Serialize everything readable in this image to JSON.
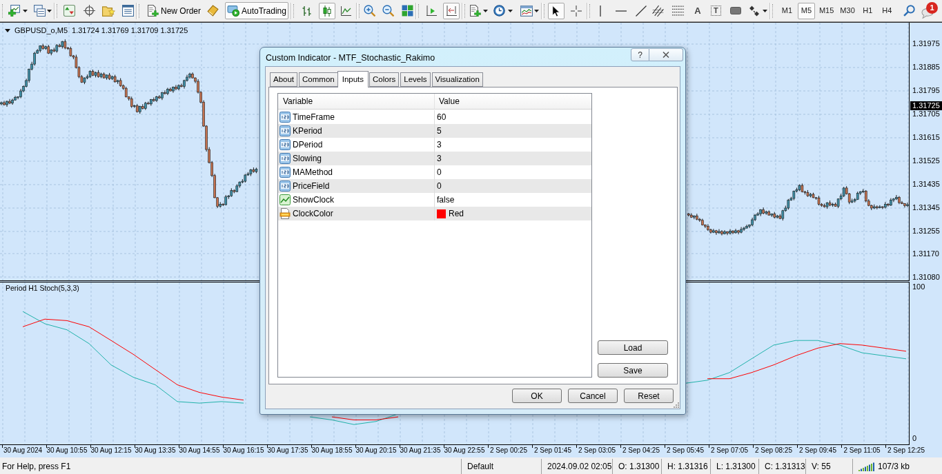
{
  "toolbar": {
    "new_order": {
      "label": "New Order"
    },
    "auto_trading": {
      "label": "AutoTrading",
      "pressed": true
    },
    "chart_types": [
      {
        "selected": false
      },
      {
        "selected": true
      },
      {
        "selected": false
      }
    ],
    "chart_shift": {
      "pressed": false
    },
    "auto_scroll": {
      "pressed": true
    },
    "pointer_tools": [
      {
        "selected": true
      },
      {
        "selected": false
      }
    ],
    "text_tool": {
      "label": "A"
    },
    "label_tool": {
      "label": "T"
    },
    "timeframes": [
      {
        "label": "M1",
        "selected": false
      },
      {
        "label": "M5",
        "selected": true
      },
      {
        "label": "M15",
        "selected": false
      },
      {
        "label": "M30",
        "selected": false
      },
      {
        "label": "H1",
        "selected": false
      },
      {
        "label": "H4",
        "selected": false
      }
    ],
    "notifications": {
      "badge": "1"
    }
  },
  "chart": {
    "symbol": "GBPUSD_o,M5",
    "ohlc": "1.31724 1.31769 1.31709 1.31725",
    "current_price": "1.31725",
    "price_chart": {
      "chart_data": {
        "type": "candlestick",
        "ylim": [
          1.31067,
          1.32057
        ],
        "grid": true,
        "yticks": [
          {
            "value": 1.31975,
            "label": "1.31975"
          },
          {
            "value": 1.31885,
            "label": "1.31885"
          },
          {
            "value": 1.31795,
            "label": "1.31795"
          },
          {
            "value": 1.31705,
            "label": "1.31705"
          },
          {
            "value": 1.31615,
            "label": "1.31615"
          },
          {
            "value": 1.31525,
            "label": "1.31525"
          },
          {
            "value": 1.31435,
            "label": "1.31435"
          },
          {
            "value": 1.31345,
            "label": "1.31345"
          },
          {
            "value": 1.31255,
            "label": "1.31255"
          },
          {
            "value": 1.3117,
            "label": "1.31170"
          },
          {
            "value": 1.3108,
            "label": "1.31080"
          }
        ],
        "categories": [
          null,
          null,
          null,
          null,
          null,
          null,
          null,
          null,
          null,
          null,
          null,
          null,
          null,
          null,
          null,
          null,
          null,
          null,
          null,
          null,
          null,
          null,
          null,
          null,
          null,
          null,
          null,
          null,
          null,
          null,
          null,
          null,
          null,
          null,
          null,
          null,
          null,
          null,
          null,
          null,
          null,
          null,
          null,
          null,
          null,
          null,
          null,
          null,
          null,
          null,
          null,
          null,
          null,
          null,
          null,
          null,
          null,
          null,
          null,
          null,
          null,
          null,
          null,
          null,
          null,
          null,
          null,
          null,
          null,
          null,
          null,
          null,
          null,
          null,
          null,
          null,
          null,
          null,
          null,
          null,
          null,
          null,
          null,
          null,
          null,
          null,
          null,
          null,
          null,
          null,
          null,
          null,
          null,
          null,
          null,
          null,
          null,
          null,
          null,
          null,
          null,
          null,
          null,
          null,
          null,
          null,
          null,
          null,
          null,
          null,
          null,
          null,
          null,
          null,
          null,
          null,
          null,
          null,
          null,
          null,
          null,
          null,
          null,
          null,
          null,
          null,
          null,
          null,
          null,
          null,
          null,
          null,
          null,
          null,
          null,
          null,
          null,
          null,
          null,
          null,
          null,
          null,
          null,
          null,
          null,
          null,
          null,
          null,
          null,
          null,
          null,
          null,
          null,
          null,
          null,
          null,
          null,
          null,
          null,
          null,
          null,
          null,
          null,
          null,
          null,
          null,
          null,
          null,
          null,
          null,
          null,
          null,
          null,
          null,
          null,
          null,
          null,
          null,
          null,
          null,
          null,
          null,
          null,
          null,
          null,
          null,
          null,
          null,
          null,
          null,
          null,
          null,
          null,
          null,
          null,
          null,
          null,
          null,
          null,
          null,
          null,
          null,
          null,
          null,
          null,
          null,
          null,
          null,
          null,
          null,
          null,
          null,
          null,
          null,
          null,
          null,
          null,
          null,
          null,
          null,
          null,
          null,
          null,
          null,
          null,
          null,
          null,
          null,
          null,
          null,
          null,
          null,
          null,
          null,
          null,
          null,
          null,
          null,
          null,
          null,
          null,
          null,
          null,
          null,
          null,
          null,
          null,
          null,
          null,
          null,
          null,
          null,
          null,
          null,
          null,
          null,
          null,
          null,
          null,
          null,
          null,
          null,
          null,
          null,
          null,
          null,
          null,
          null,
          null,
          null,
          null,
          null,
          null,
          null,
          null,
          null,
          null,
          null,
          null,
          null,
          null,
          null,
          null,
          null,
          null,
          null,
          null,
          null,
          null,
          null,
          null,
          null,
          null,
          null,
          null,
          null,
          null,
          null,
          null,
          null,
          null,
          null,
          null,
          null,
          null,
          null,
          null,
          null,
          null,
          null,
          null,
          null,
          null,
          null,
          null,
          null,
          null,
          null,
          null,
          null,
          null,
          null,
          null,
          null,
          null,
          null,
          null,
          null
        ],
        "ohlc": [
          [
            1.31745,
            1.31754,
            1.3174,
            1.3175
          ],
          [
            1.3175,
            1.31757,
            1.31739,
            1.31742
          ],
          [
            1.31742,
            1.31758,
            1.31734,
            1.31755
          ],
          [
            1.31755,
            1.31764,
            1.31744,
            1.31748
          ],
          [
            1.31748,
            1.31765,
            1.31742,
            1.3176
          ],
          [
            1.3176,
            1.31776,
            1.31758,
            1.3177
          ],
          [
            1.3177,
            1.31774,
            1.31763,
            1.31772
          ],
          [
            1.31772,
            1.31803,
            1.31767,
            1.31795
          ],
          [
            1.31795,
            1.31816,
            1.3179,
            1.31812
          ],
          [
            1.31812,
            1.31842,
            1.31809,
            1.31835
          ],
          [
            1.31835,
            1.31881,
            1.31827,
            1.31878
          ],
          [
            1.31878,
            1.31907,
            1.31874,
            1.31898
          ],
          [
            1.31898,
            1.31945,
            1.31892,
            1.3194
          ],
          [
            1.3194,
            1.31956,
            1.31938,
            1.3195
          ],
          [
            1.3195,
            1.3197,
            1.31943,
            1.31968
          ],
          [
            1.31968,
            1.31976,
            1.31953,
            1.31958
          ],
          [
            1.31958,
            1.31969,
            1.31953,
            1.31965
          ],
          [
            1.31965,
            1.31972,
            1.31937,
            1.3194
          ],
          [
            1.3194,
            1.31955,
            1.31932,
            1.31952
          ],
          [
            1.31952,
            1.31961,
            1.31944,
            1.31948
          ],
          [
            1.31948,
            1.31975,
            1.31942,
            1.3197
          ],
          [
            1.3197,
            1.31976,
            1.31963,
            1.31965
          ],
          [
            1.31965,
            1.31987,
            1.31958,
            1.31985
          ],
          [
            1.31985,
            1.31993,
            1.31955,
            1.3196
          ],
          [
            1.3196,
            1.31964,
            1.31953,
            1.31958
          ],
          [
            1.31958,
            1.31965,
            1.31927,
            1.3193
          ],
          [
            1.3193,
            1.31933,
            1.31917,
            1.31925
          ],
          [
            1.31925,
            1.31934,
            1.31881,
            1.31885
          ],
          [
            1.31885,
            1.3189,
            1.31844,
            1.3185
          ],
          [
            1.3185,
            1.31856,
            1.31826,
            1.31828
          ],
          [
            1.31828,
            1.31847,
            1.31821,
            1.31845
          ],
          [
            1.31845,
            1.31858,
            1.3184,
            1.3185
          ],
          [
            1.3185,
            1.31874,
            1.31845,
            1.3187
          ],
          [
            1.3187,
            1.31877,
            1.31852,
            1.31855
          ],
          [
            1.31855,
            1.31869,
            1.31847,
            1.31866
          ],
          [
            1.31866,
            1.31875,
            1.31846,
            1.3185
          ],
          [
            1.3185,
            1.31865,
            1.31844,
            1.3186
          ],
          [
            1.3186,
            1.31866,
            1.31843,
            1.31845
          ],
          [
            1.31845,
            1.31858,
            1.31838,
            1.31856
          ],
          [
            1.31856,
            1.31864,
            1.31837,
            1.31842
          ],
          [
            1.31842,
            1.31854,
            1.31837,
            1.3185
          ],
          [
            1.3185,
            1.31857,
            1.31827,
            1.3183
          ],
          [
            1.3183,
            1.31838,
            1.31822,
            1.31835
          ],
          [
            1.31835,
            1.31844,
            1.31811,
            1.31815
          ],
          [
            1.31815,
            1.3182,
            1.31799,
            1.31805
          ],
          [
            1.31805,
            1.31811,
            1.3177,
            1.31772
          ],
          [
            1.31772,
            1.31774,
            1.31758,
            1.31765
          ],
          [
            1.31765,
            1.31773,
            1.3173,
            1.31735
          ],
          [
            1.31735,
            1.31742,
            1.3173,
            1.31738
          ],
          [
            1.31738,
            1.31745,
            1.31712,
            1.31715
          ],
          [
            1.31715,
            1.31738,
            1.31707,
            1.31735
          ],
          [
            1.31735,
            1.31744,
            1.31724,
            1.31728
          ],
          [
            1.31728,
            1.31753,
            1.31722,
            1.31748
          ],
          [
            1.31748,
            1.31754,
            1.31743,
            1.31745
          ],
          [
            1.31745,
            1.31764,
            1.31738,
            1.31762
          ],
          [
            1.31762,
            1.3177,
            1.31753,
            1.31758
          ],
          [
            1.31758,
            1.31776,
            1.31753,
            1.31772
          ],
          [
            1.31772,
            1.31779,
            1.31765,
            1.31768
          ],
          [
            1.31768,
            1.31791,
            1.3176,
            1.31788
          ],
          [
            1.31788,
            1.31797,
            1.31781,
            1.31785
          ],
          [
            1.31785,
            1.31807,
            1.31779,
            1.31802
          ],
          [
            1.31802,
            1.31808,
            1.31793,
            1.31795
          ],
          [
            1.31795,
            1.31812,
            1.31788,
            1.3181
          ],
          [
            1.3181,
            1.31818,
            1.31798,
            1.31803
          ],
          [
            1.31803,
            1.3182,
            1.31798,
            1.31816
          ],
          [
            1.31816,
            1.31823,
            1.31809,
            1.31812
          ],
          [
            1.31812,
            1.31838,
            1.31804,
            1.31835
          ],
          [
            1.31835,
            1.31857,
            1.31831,
            1.31848
          ],
          [
            1.31848,
            1.31865,
            1.31842,
            1.3186
          ],
          [
            1.3186,
            1.31866,
            1.31843,
            1.31845
          ],
          [
            1.31845,
            1.31847,
            1.31825,
            1.31832
          ],
          [
            1.31832,
            1.3184,
            1.31785,
            1.3179
          ],
          [
            1.3179,
            1.31794,
            1.31747,
            1.31752
          ],
          [
            1.31752,
            1.31759,
            1.31657,
            1.3166
          ],
          [
            1.3166,
            1.31663,
            1.31562,
            1.3157
          ],
          [
            1.3157,
            1.31579,
            1.31516,
            1.3152
          ],
          [
            1.3152,
            1.31525,
            1.31464,
            1.3147
          ],
          [
            1.3147,
            1.31476,
            1.31383,
            1.31385
          ],
          [
            1.31385,
            1.31387,
            1.31345,
            1.31352
          ],
          [
            1.31352,
            1.31368,
            1.31347,
            1.3136
          ],
          [
            1.3136,
            1.31364,
            1.31353,
            1.31358
          ],
          [
            1.31358,
            1.31395,
            1.31355,
            1.31388
          ],
          [
            1.31388,
            1.31395,
            1.3138,
            1.31392
          ],
          [
            1.31392,
            1.31421,
            1.31388,
            1.31412
          ],
          [
            1.31412,
            1.31417,
            1.31402,
            1.31408
          ],
          [
            1.31408,
            1.31436,
            1.31406,
            1.3143
          ],
          [
            1.3143,
            1.31447,
            1.31423,
            1.31445
          ],
          [
            1.31445,
            1.31456,
            1.3144,
            1.31448
          ],
          [
            1.31448,
            1.31476,
            1.31443,
            1.31472
          ],
          [
            1.31472,
            1.31483,
            1.31469,
            1.31476
          ],
          [
            1.31476,
            1.31495,
            1.31468,
            1.31492
          ],
          [
            1.31492,
            1.31501,
            1.31481,
            1.31485
          ],
          [
            1.31485,
            1.315,
            1.31479,
            1.31495
          ],
          null,
          null,
          null,
          null,
          null,
          null,
          null,
          null,
          null,
          null,
          null,
          null,
          null,
          null,
          null,
          null,
          null,
          null,
          null,
          null,
          null,
          null,
          null,
          null,
          null,
          null,
          null,
          null,
          null,
          null,
          null,
          null,
          null,
          null,
          null,
          null,
          null,
          null,
          null,
          null,
          null,
          null,
          null,
          null,
          null,
          null,
          null,
          null,
          null,
          null,
          null,
          null,
          null,
          null,
          null,
          null,
          null,
          null,
          null,
          null,
          null,
          null,
          null,
          null,
          null,
          null,
          null,
          null,
          null,
          null,
          null,
          null,
          null,
          null,
          null,
          null,
          null,
          null,
          null,
          null,
          null,
          null,
          null,
          null,
          null,
          null,
          null,
          null,
          null,
          null,
          null,
          null,
          null,
          null,
          null,
          null,
          null,
          null,
          null,
          null,
          null,
          null,
          null,
          null,
          null,
          null,
          null,
          null,
          null,
          null,
          null,
          null,
          null,
          null,
          null,
          null,
          null,
          null,
          null,
          null,
          null,
          null,
          null,
          null,
          null,
          null,
          null,
          null,
          null,
          null,
          null,
          null,
          null,
          null,
          null,
          null,
          null,
          null,
          null,
          null,
          null,
          null,
          null,
          null,
          null,
          null,
          null,
          null,
          null,
          null,
          null,
          null,
          null,
          null,
          null,
          [
            1.31322,
            1.31326,
            1.31313,
            1.31318
          ],
          [
            1.31318,
            1.31325,
            1.31307,
            1.3131
          ],
          [
            1.3131,
            1.31317,
            1.31302,
            1.31314
          ],
          [
            1.31314,
            1.31323,
            1.31298,
            1.31302
          ],
          [
            1.31302,
            1.31307,
            1.31292,
            1.31298
          ],
          [
            1.31298,
            1.31304,
            1.31278,
            1.3128
          ],
          [
            1.3128,
            1.31282,
            1.31268,
            1.31275
          ],
          [
            1.31275,
            1.31283,
            1.31257,
            1.31262
          ],
          [
            1.31262,
            1.31266,
            1.31247,
            1.31252
          ],
          [
            1.31252,
            1.31265,
            1.31249,
            1.31258
          ],
          [
            1.31258,
            1.31261,
            1.31242,
            1.3125
          ],
          [
            1.3125,
            1.31264,
            1.31246,
            1.31255
          ],
          [
            1.31255,
            1.3126,
            1.3124,
            1.31246
          ],
          [
            1.31246,
            1.3126,
            1.31244,
            1.31254
          ],
          [
            1.31254,
            1.31256,
            1.31241,
            1.31248
          ],
          [
            1.31248,
            1.31264,
            1.31243,
            1.31256
          ],
          [
            1.31256,
            1.3126,
            1.31245,
            1.3125
          ],
          [
            1.3125,
            1.31265,
            1.31247,
            1.31258
          ],
          [
            1.31258,
            1.31261,
            1.31244,
            1.31252
          ],
          [
            1.31252,
            1.31272,
            1.31248,
            1.31263
          ],
          [
            1.31263,
            1.31273,
            1.31257,
            1.31268
          ],
          [
            1.31268,
            1.31281,
            1.31266,
            1.31275
          ],
          [
            1.31275,
            1.31282,
            1.31268,
            1.3128
          ],
          [
            1.3128,
            1.31308,
            1.31275,
            1.313
          ],
          [
            1.313,
            1.31322,
            1.31295,
            1.31318
          ],
          [
            1.31318,
            1.31329,
            1.31315,
            1.31322
          ],
          [
            1.31322,
            1.31341,
            1.31314,
            1.31338
          ],
          [
            1.31338,
            1.31347,
            1.31321,
            1.31325
          ],
          [
            1.31325,
            1.31335,
            1.31319,
            1.3133
          ],
          [
            1.3133,
            1.31336,
            1.31316,
            1.31318
          ],
          [
            1.31318,
            1.31324,
            1.31311,
            1.31322
          ],
          [
            1.31322,
            1.3133,
            1.31305,
            1.3131
          ],
          [
            1.3131,
            1.31319,
            1.31305,
            1.31315
          ],
          [
            1.31315,
            1.31322,
            1.31302,
            1.31305
          ],
          [
            1.31305,
            1.31338,
            1.31297,
            1.31335
          ],
          [
            1.31335,
            1.31354,
            1.31331,
            1.31345
          ],
          [
            1.31345,
            1.3138,
            1.31339,
            1.31375
          ],
          [
            1.31375,
            1.31388,
            1.31373,
            1.31382
          ],
          [
            1.31382,
            1.31412,
            1.31375,
            1.3141
          ],
          [
            1.3141,
            1.31423,
            1.31405,
            1.31415
          ],
          [
            1.31415,
            1.31436,
            1.3141,
            1.31432
          ],
          [
            1.31432,
            1.31439,
            1.31405,
            1.31408
          ],
          [
            1.31408,
            1.31411,
            1.31397,
            1.31405
          ],
          [
            1.31405,
            1.31414,
            1.31388,
            1.31392
          ],
          [
            1.31392,
            1.31403,
            1.31386,
            1.31398
          ],
          [
            1.31398,
            1.31404,
            1.31383,
            1.31385
          ],
          [
            1.31385,
            1.31387,
            1.31377,
            1.31384
          ],
          [
            1.31384,
            1.31392,
            1.31355,
            1.3136
          ],
          [
            1.3136,
            1.31364,
            1.3135,
            1.31355
          ],
          [
            1.31355,
            1.31362,
            1.31347,
            1.3135
          ],
          [
            1.3135,
            1.31368,
            1.31342,
            1.31365
          ],
          [
            1.31365,
            1.31374,
            1.31352,
            1.31356
          ],
          [
            1.31356,
            1.31365,
            1.3135,
            1.3136
          ],
          [
            1.3136,
            1.31366,
            1.3135,
            1.31352
          ],
          [
            1.31352,
            1.31382,
            1.31345,
            1.3138
          ],
          [
            1.3138,
            1.314,
            1.31375,
            1.31392
          ],
          [
            1.31392,
            1.31426,
            1.31387,
            1.31422
          ],
          [
            1.31422,
            1.31429,
            1.31397,
            1.314
          ],
          [
            1.314,
            1.31403,
            1.3136,
            1.31368
          ],
          [
            1.31368,
            1.31381,
            1.31364,
            1.31372
          ],
          [
            1.31372,
            1.31383,
            1.31366,
            1.31378
          ],
          [
            1.31378,
            1.31408,
            1.31376,
            1.31402
          ],
          [
            1.31402,
            1.3141,
            1.31395,
            1.31408
          ],
          [
            1.31408,
            1.31418,
            1.31403,
            1.3141
          ],
          [
            1.3141,
            1.31414,
            1.31367,
            1.31372
          ],
          [
            1.31372,
            1.31379,
            1.31352,
            1.31355
          ],
          [
            1.31355,
            1.31358,
            1.31337,
            1.31345
          ],
          [
            1.31345,
            1.31359,
            1.31341,
            1.3135
          ],
          [
            1.3135,
            1.31355,
            1.3134,
            1.31346
          ],
          [
            1.31346,
            1.31356,
            1.31344,
            1.3135
          ],
          [
            1.3135,
            1.31352,
            1.31341,
            1.31348
          ],
          [
            1.31348,
            1.31368,
            1.31343,
            1.3136
          ],
          [
            1.3136,
            1.31364,
            1.31351,
            1.31356
          ],
          [
            1.31356,
            1.31383,
            1.31353,
            1.31376
          ],
          [
            1.31376,
            1.31383,
            1.31368,
            1.3138
          ],
          [
            1.3138,
            1.31395,
            1.31376,
            1.31386
          ],
          [
            1.31386,
            1.31391,
            1.3136,
            1.31366
          ],
          [
            1.31366,
            1.31372,
            1.3136,
            1.31362
          ],
          [
            1.31362,
            1.31364,
            1.31347,
            1.31354
          ],
          [
            1.31354,
            1.31366,
            1.31349,
            1.31358
          ]
        ]
      }
    },
    "indicator": {
      "chart_data": {
        "type": "line",
        "title": "Period H1 Stoch(5,3,3)",
        "categories": [
          "30 Aug 2024",
          null,
          "30 Aug 10:55",
          null,
          "30 Aug 12:15",
          null,
          "30 Aug 13:35",
          null,
          "30 Aug 14:55",
          null,
          "30 Aug 16:15",
          null,
          "30 Aug 17:35",
          null,
          "30 Aug 18:55",
          null,
          "30 Aug 20:15",
          null,
          "30 Aug 21:35",
          null,
          "30 Aug 22:55",
          null,
          "2 Sep 00:25",
          null,
          "2 Sep 01:45",
          null,
          "2 Sep 03:05",
          null,
          "2 Sep 04:25",
          null,
          "2 Sep 05:45",
          null,
          "2 Sep 07:05",
          null,
          "2 Sep 08:25",
          null,
          "2 Sep 09:45",
          null,
          "2 Sep 11:05",
          null,
          "2 Sep 12:25"
        ],
        "ylim": [
          -4,
          102
        ],
        "yticks": [
          0,
          100
        ],
        "grid": true,
        "series": [
          {
            "color": "#20b2aa",
            "values": [
              83,
              75,
              71,
              62,
              48,
              40,
              35,
              24,
              23,
              24,
              23,
              null,
              null,
              14,
              12,
              9,
              11,
              16,
              null,
              null,
              null,
              null,
              null,
              null,
              null,
              null,
              null,
              null,
              null,
              null,
              36,
              38,
              43,
              52,
              61,
              64,
              64,
              61,
              56,
              54,
              52
            ]
          },
          {
            "color": "#ff0000",
            "values": [
              73,
              78,
              77,
              73,
              64,
              55,
              45,
              35,
              30,
              27,
              25,
              null,
              null,
              null,
              14,
              12,
              12,
              14,
              null,
              null,
              null,
              null,
              null,
              null,
              null,
              null,
              null,
              null,
              null,
              null,
              null,
              39,
              39,
              43,
              48,
              54,
              59,
              62,
              61,
              59,
              57
            ]
          }
        ]
      }
    }
  },
  "dialog": {
    "title": "Custom Indicator - MTF_Stochastic_Rakimo",
    "help_label": "?",
    "tabs": [
      {
        "label": "About",
        "selected": false
      },
      {
        "label": "Common",
        "selected": false
      },
      {
        "label": "Inputs",
        "selected": true
      },
      {
        "label": "Colors",
        "selected": false
      },
      {
        "label": "Levels",
        "selected": false
      },
      {
        "label": "Visualization",
        "selected": false
      }
    ],
    "table": {
      "columns": [
        "Variable",
        "Value"
      ],
      "rows": [
        {
          "kind": "int",
          "variable": "TimeFrame",
          "value": "60"
        },
        {
          "kind": "int",
          "variable": "KPeriod",
          "value": "5"
        },
        {
          "kind": "int",
          "variable": "DPeriod",
          "value": "3"
        },
        {
          "kind": "int",
          "variable": "Slowing",
          "value": "3"
        },
        {
          "kind": "int",
          "variable": "MAMethod",
          "value": "0"
        },
        {
          "kind": "int",
          "variable": "PriceField",
          "value": "0"
        },
        {
          "kind": "bool",
          "variable": "ShowClock",
          "value": "false"
        },
        {
          "kind": "color",
          "variable": "ClockColor",
          "value": "Red",
          "color": "#ff0000"
        }
      ]
    },
    "side_buttons": [
      "Load",
      "Save"
    ],
    "buttons": [
      "OK",
      "Cancel",
      "Reset"
    ]
  },
  "status_bar": [
    {
      "kind": "text",
      "text": "For Help, press F1"
    },
    {
      "kind": "text",
      "text": "Default"
    },
    {
      "kind": "text",
      "text": "2024.09.02 02:05"
    },
    {
      "kind": "text",
      "text": "O: 1.31300"
    },
    {
      "kind": "text",
      "text": "H: 1.31316"
    },
    {
      "kind": "text",
      "text": "L: 1.31300"
    },
    {
      "kind": "text",
      "text": "C: 1.31313"
    },
    {
      "kind": "text",
      "text": "V: 55"
    },
    {
      "kind": "connection",
      "text": "107/3 kb"
    }
  ]
}
